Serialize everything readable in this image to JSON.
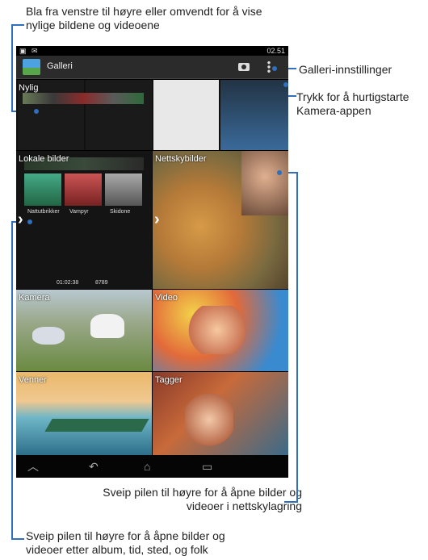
{
  "callouts": {
    "swipe_recent": "Bla fra venstre til høyre eller omvendt for å vise nylige bildene og videoene",
    "settings": "Galleri-innstillinger",
    "camera": "Trykk for å hurtigstarte Kamera-appen",
    "cloud": "Sveip pilen til høyre for å åpne bilder og videoer i nettskylagring",
    "local": "Sveip pilen til høyre for å åpne bilder og videoer etter album, tid, sted, og folk"
  },
  "statusbar": {
    "time": "02.51"
  },
  "app": {
    "title": "Galleri",
    "camera_icon": "camera-icon",
    "menu_icon": "overflow-menu-icon"
  },
  "tiles": {
    "recent": "Nylig",
    "local": "Lokale bilder",
    "cloud": "Nettskybilder",
    "camera": "Kamera",
    "video": "Video",
    "friends": "Venner",
    "tags": "Tagger"
  },
  "local_thumbs": [
    "Nattutbrikker",
    "Vampyr",
    "Skidone"
  ],
  "local_meta": {
    "duration": "01:02:38",
    "count": "8789"
  },
  "nav": {
    "back": "back-icon",
    "home": "home-icon",
    "recent": "recent-apps-icon",
    "down": "hide-keyboard-icon"
  }
}
